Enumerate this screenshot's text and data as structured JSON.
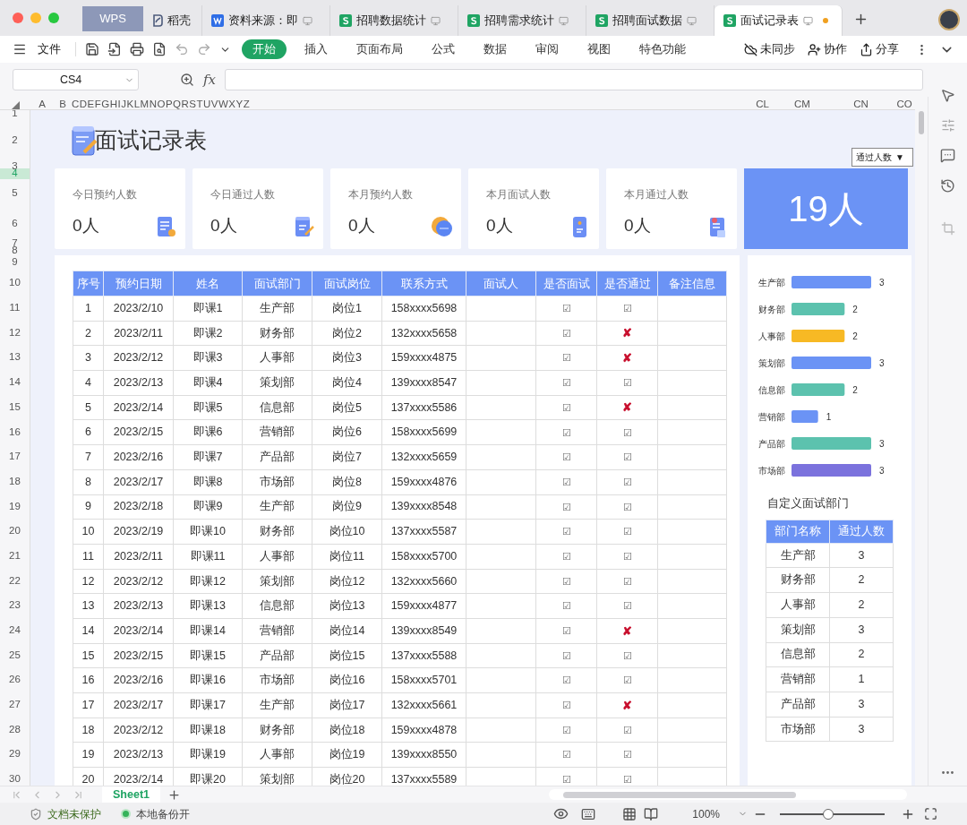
{
  "tabs": [
    {
      "label": "WPS",
      "kind": "home",
      "selected": false
    },
    {
      "label": "稻壳",
      "kind": "docer",
      "selected": false
    },
    {
      "label": "资料来源：即",
      "kind": "doc",
      "selected": false
    },
    {
      "label": "招聘数据统计",
      "kind": "sheet",
      "selected": false
    },
    {
      "label": "招聘需求统计",
      "kind": "sheet",
      "selected": false
    },
    {
      "label": "招聘面试数据",
      "kind": "sheet",
      "selected": false
    },
    {
      "label": "面试记录表",
      "kind": "sheet",
      "selected": true,
      "unsaved": true
    }
  ],
  "menu": {
    "file": "文件",
    "ribbon_tabs": [
      {
        "label": "开始",
        "selected": true
      },
      {
        "label": "插入",
        "selected": false
      },
      {
        "label": "页面布局",
        "selected": false
      },
      {
        "label": "公式",
        "selected": false
      },
      {
        "label": "数据",
        "selected": false
      },
      {
        "label": "审阅",
        "selected": false
      },
      {
        "label": "视图",
        "selected": false
      },
      {
        "label": "特色功能",
        "selected": false
      }
    ],
    "actions": [
      {
        "label": "未同步",
        "kind": "sync"
      },
      {
        "label": "协作",
        "kind": "collab"
      },
      {
        "label": "分享",
        "kind": "share"
      }
    ]
  },
  "formula_bar": {
    "name_box": "CS4",
    "fx": "fx"
  },
  "column_headers": [
    "A",
    "B",
    "CDEFGHIJKLMNOPQRSTUVWXYZ",
    "CL",
    "CM",
    "CN",
    "CO"
  ],
  "row_numbers": [
    "1",
    "2",
    "3",
    "4",
    "5",
    "6",
    "7",
    "8",
    "9",
    "10",
    "11",
    "12",
    "13",
    "14",
    "15",
    "16",
    "17",
    "18",
    "19",
    "20",
    "21",
    "22",
    "23",
    "24",
    "25",
    "26",
    "27",
    "28",
    "29",
    "30"
  ],
  "sheet": {
    "title": "面试记录表",
    "dropdown": {
      "value": "通过人数",
      "arrow": "▼"
    },
    "cards": [
      {
        "label": "今日预约人数",
        "value": "0人"
      },
      {
        "label": "今日通过人数",
        "value": "0人"
      },
      {
        "label": "本月预约人数",
        "value": "0人"
      },
      {
        "label": "本月面试人数",
        "value": "0人"
      },
      {
        "label": "本月通过人数",
        "value": "0人"
      }
    ],
    "total": "19人",
    "table": {
      "columns": [
        "序号",
        "预约日期",
        "姓名",
        "面试部门",
        "面试岗位",
        "联系方式",
        "面试人",
        "是否面试",
        "是否通过",
        "备注信息"
      ],
      "rows": [
        {
          "no": "1",
          "date": "2023/2/10",
          "name": "即课1",
          "dept": "生产部",
          "post": "岗位1",
          "phone": "158xxxx5698",
          "interviewed": "☑",
          "passed_mark": "☑",
          "passed": true
        },
        {
          "no": "2",
          "date": "2023/2/11",
          "name": "即课2",
          "dept": "财务部",
          "post": "岗位2",
          "phone": "132xxxx5658",
          "interviewed": "☑",
          "passed_mark": "✘",
          "passed": false
        },
        {
          "no": "3",
          "date": "2023/2/12",
          "name": "即课3",
          "dept": "人事部",
          "post": "岗位3",
          "phone": "159xxxx4875",
          "interviewed": "☑",
          "passed_mark": "✘",
          "passed": false
        },
        {
          "no": "4",
          "date": "2023/2/13",
          "name": "即课4",
          "dept": "策划部",
          "post": "岗位4",
          "phone": "139xxxx8547",
          "interviewed": "☑",
          "passed_mark": "☑",
          "passed": true
        },
        {
          "no": "5",
          "date": "2023/2/14",
          "name": "即课5",
          "dept": "信息部",
          "post": "岗位5",
          "phone": "137xxxx5586",
          "interviewed": "☑",
          "passed_mark": "✘",
          "passed": false
        },
        {
          "no": "6",
          "date": "2023/2/15",
          "name": "即课6",
          "dept": "营销部",
          "post": "岗位6",
          "phone": "158xxxx5699",
          "interviewed": "☑",
          "passed_mark": "☑",
          "passed": true
        },
        {
          "no": "7",
          "date": "2023/2/16",
          "name": "即课7",
          "dept": "产品部",
          "post": "岗位7",
          "phone": "132xxxx5659",
          "interviewed": "☑",
          "passed_mark": "☑",
          "passed": true
        },
        {
          "no": "8",
          "date": "2023/2/17",
          "name": "即课8",
          "dept": "市场部",
          "post": "岗位8",
          "phone": "159xxxx4876",
          "interviewed": "☑",
          "passed_mark": "☑",
          "passed": true
        },
        {
          "no": "9",
          "date": "2023/2/18",
          "name": "即课9",
          "dept": "生产部",
          "post": "岗位9",
          "phone": "139xxxx8548",
          "interviewed": "☑",
          "passed_mark": "☑",
          "passed": true
        },
        {
          "no": "10",
          "date": "2023/2/19",
          "name": "即课10",
          "dept": "财务部",
          "post": "岗位10",
          "phone": "137xxxx5587",
          "interviewed": "☑",
          "passed_mark": "☑",
          "passed": true
        },
        {
          "no": "11",
          "date": "2023/2/11",
          "name": "即课11",
          "dept": "人事部",
          "post": "岗位11",
          "phone": "158xxxx5700",
          "interviewed": "☑",
          "passed_mark": "☑",
          "passed": true
        },
        {
          "no": "12",
          "date": "2023/2/12",
          "name": "即课12",
          "dept": "策划部",
          "post": "岗位12",
          "phone": "132xxxx5660",
          "interviewed": "☑",
          "passed_mark": "☑",
          "passed": true
        },
        {
          "no": "13",
          "date": "2023/2/13",
          "name": "即课13",
          "dept": "信息部",
          "post": "岗位13",
          "phone": "159xxxx4877",
          "interviewed": "☑",
          "passed_mark": "☑",
          "passed": true
        },
        {
          "no": "14",
          "date": "2023/2/14",
          "name": "即课14",
          "dept": "营销部",
          "post": "岗位14",
          "phone": "139xxxx8549",
          "interviewed": "☑",
          "passed_mark": "✘",
          "passed": false
        },
        {
          "no": "15",
          "date": "2023/2/15",
          "name": "即课15",
          "dept": "产品部",
          "post": "岗位15",
          "phone": "137xxxx5588",
          "interviewed": "☑",
          "passed_mark": "☑",
          "passed": true
        },
        {
          "no": "16",
          "date": "2023/2/16",
          "name": "即课16",
          "dept": "市场部",
          "post": "岗位16",
          "phone": "158xxxx5701",
          "interviewed": "☑",
          "passed_mark": "☑",
          "passed": true
        },
        {
          "no": "17",
          "date": "2023/2/17",
          "name": "即课17",
          "dept": "生产部",
          "post": "岗位17",
          "phone": "132xxxx5661",
          "interviewed": "☑",
          "passed_mark": "✘",
          "passed": false
        },
        {
          "no": "18",
          "date": "2023/2/12",
          "name": "即课18",
          "dept": "财务部",
          "post": "岗位18",
          "phone": "159xxxx4878",
          "interviewed": "☑",
          "passed_mark": "☑",
          "passed": true
        },
        {
          "no": "19",
          "date": "2023/2/13",
          "name": "即课19",
          "dept": "人事部",
          "post": "岗位19",
          "phone": "139xxxx8550",
          "interviewed": "☑",
          "passed_mark": "☑",
          "passed": true
        },
        {
          "no": "20",
          "date": "2023/2/14",
          "name": "即课20",
          "dept": "策划部",
          "post": "岗位20",
          "phone": "137xxxx5589",
          "interviewed": "☑",
          "passed_mark": "☑",
          "passed": true
        }
      ]
    },
    "chart_data": {
      "type": "bar",
      "orientation": "horizontal",
      "categories": [
        "生产部",
        "财务部",
        "人事部",
        "策划部",
        "信息部",
        "营销部",
        "产品部",
        "市场部"
      ],
      "series": [
        {
          "values": [
            3,
            2,
            2,
            3,
            2,
            1,
            3,
            3
          ]
        }
      ],
      "colors": [
        "#6b93f5",
        "#5cc2ae",
        "#f7b924",
        "#6b93f5",
        "#5cc2ae",
        "#6b93f5",
        "#5cc2ae",
        "#7b72dd"
      ],
      "xlim": [
        0,
        3
      ],
      "data_labels": true
    },
    "dept_table": {
      "title": "自定义面试部门",
      "columns": [
        "部门名称",
        "通过人数"
      ],
      "rows": [
        [
          "生产部",
          "3"
        ],
        [
          "财务部",
          "2"
        ],
        [
          "人事部",
          "2"
        ],
        [
          "策划部",
          "3"
        ],
        [
          "信息部",
          "2"
        ],
        [
          "营销部",
          "1"
        ],
        [
          "产品部",
          "3"
        ],
        [
          "市场部",
          "3"
        ]
      ]
    }
  },
  "sheet_tabs": [
    {
      "label": "Sheet1",
      "selected": true
    }
  ],
  "status_bar": {
    "protection": "文档未保护",
    "backup": "本地备份开",
    "zoom": "100%",
    "zoom_slider": {
      "level": 0.46
    }
  }
}
